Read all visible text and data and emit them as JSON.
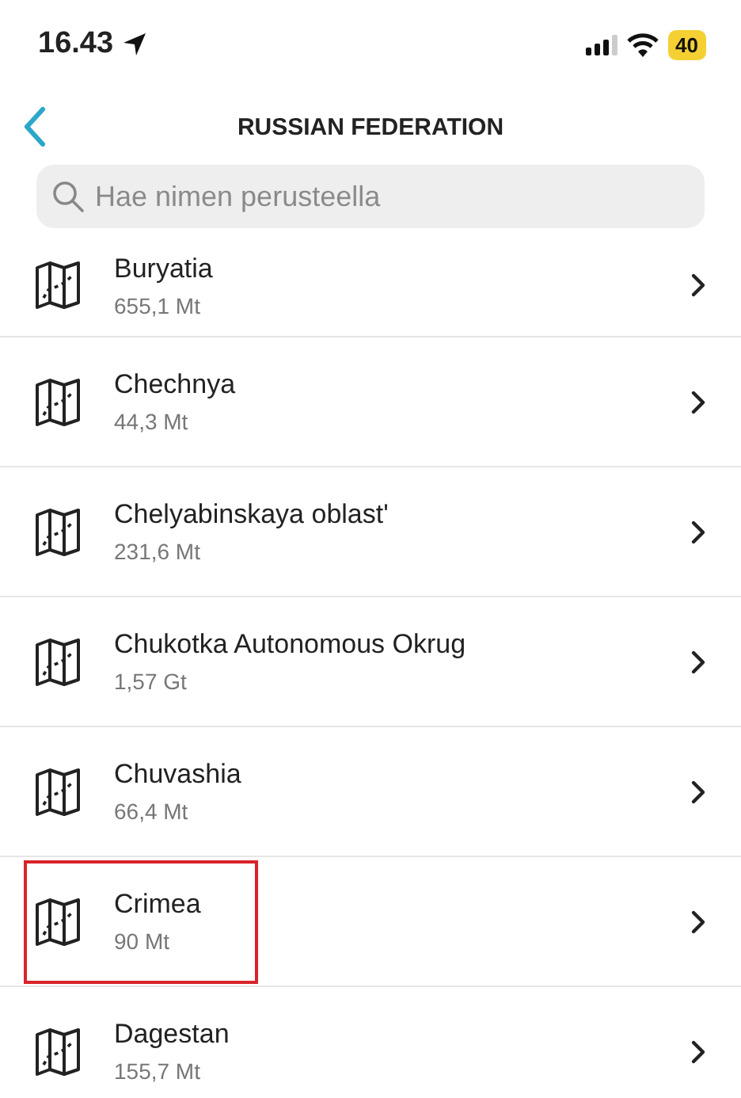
{
  "status_bar": {
    "time": "16.43",
    "battery": "40"
  },
  "nav": {
    "title": "RUSSIAN FEDERATION"
  },
  "search": {
    "placeholder": "Hae nimen perusteella"
  },
  "regions": [
    {
      "name": "Buryatia",
      "size": "655,1 Mt",
      "highlighted": false
    },
    {
      "name": "Chechnya",
      "size": "44,3 Mt",
      "highlighted": false
    },
    {
      "name": "Chelyabinskaya oblast'",
      "size": "231,6 Mt",
      "highlighted": false
    },
    {
      "name": "Chukotka Autonomous Okrug",
      "size": "1,57 Gt",
      "highlighted": false
    },
    {
      "name": "Chuvashia",
      "size": "66,4 Mt",
      "highlighted": false
    },
    {
      "name": "Crimea",
      "size": "90 Mt",
      "highlighted": true
    },
    {
      "name": "Dagestan",
      "size": "155,7 Mt",
      "highlighted": false
    }
  ]
}
